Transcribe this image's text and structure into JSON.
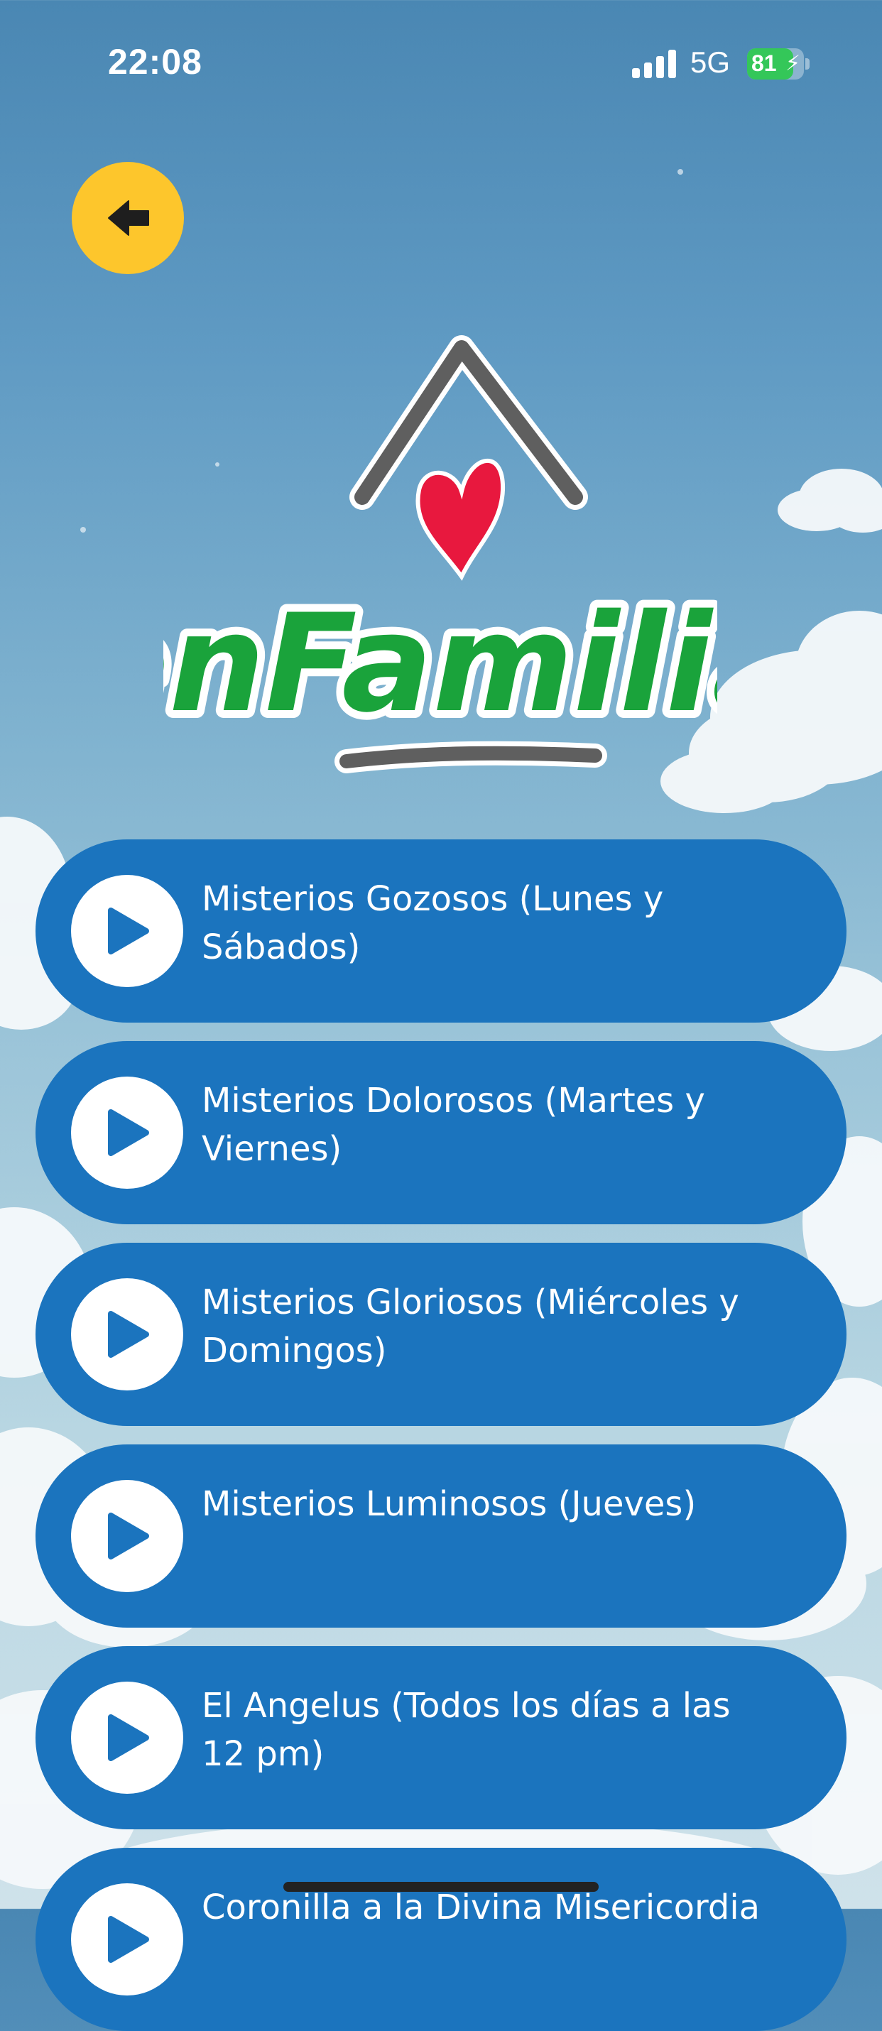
{
  "status_bar": {
    "time": "22:08",
    "network": "5G",
    "battery_percent": "81",
    "battery_level": 0.81,
    "battery_charging": true,
    "signal_icon": "signal-bars-icon"
  },
  "back_button": {
    "icon": "arrow-left-icon"
  },
  "logo": {
    "text": "enFamilia",
    "colors": {
      "roof": "#5f5f5f",
      "heart": "#e8183e",
      "text": "#1aa33b",
      "underline": "#5f5f5f"
    }
  },
  "colors": {
    "button_bg": "#1b74be",
    "back_button_bg": "#fdc62c",
    "play_circle_bg": "#ffffff",
    "play_icon": "#1b74be"
  },
  "menu": {
    "items": [
      {
        "label": "Misterios Gozosos (Lunes y Sábados)",
        "icon": "play-icon"
      },
      {
        "label": "Misterios Dolorosos (Martes y Viernes)",
        "icon": "play-icon"
      },
      {
        "label": "Misterios Gloriosos (Miércoles y Domingos)",
        "icon": "play-icon"
      },
      {
        "label": "Misterios Luminosos (Jueves)",
        "icon": "play-icon"
      },
      {
        "label": "El Angelus (Todos los días a las 12 pm)",
        "icon": "play-icon"
      },
      {
        "label": "Coronilla a la Divina Misericordia",
        "icon": "play-icon"
      }
    ]
  }
}
